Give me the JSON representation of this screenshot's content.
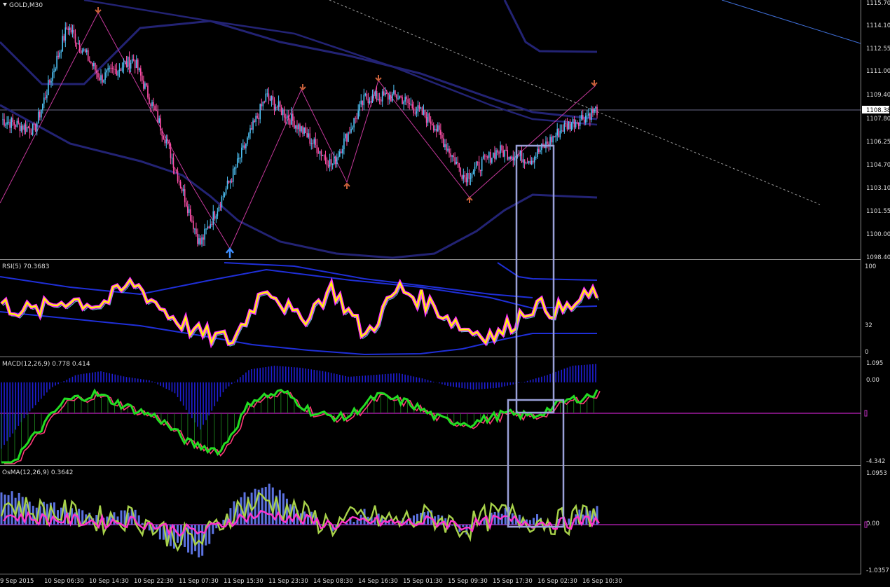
{
  "window": {
    "symbol_label": "GOLD,M30",
    "menu_icon": "triangle-down-icon"
  },
  "current_price": "1108.38",
  "panes": {
    "main": {
      "ticks": [
        "1115.70",
        "1114.10",
        "1112.55",
        "1111.00",
        "1109.40",
        "1107.80",
        "1106.25",
        "1104.70",
        "1103.10",
        "1101.55",
        "1100.00",
        "1098.40"
      ]
    },
    "rsi": {
      "label": "RSI(5) 70.3683",
      "ticks": [
        "100",
        "32",
        "0"
      ]
    },
    "macd": {
      "label": "MACD(12,26,9) 0.778 0.414",
      "ticks": [
        "1.095",
        "0.00",
        "-4.342"
      ]
    },
    "osma": {
      "label": "OsMA(12,26,9) 0.3642",
      "ticks": [
        "1.0953",
        "0.00",
        "-1.0357"
      ]
    }
  },
  "time_labels": [
    "9 Sep 2015",
    "10 Sep 06:30",
    "10 Sep 14:30",
    "10 Sep 22:30",
    "11 Sep 07:30",
    "11 Sep 15:30",
    "11 Sep 23:30",
    "14 Sep 08:30",
    "14 Sep 16:30",
    "15 Sep 01:30",
    "15 Sep 09:30",
    "15 Sep 17:30",
    "16 Sep 02:30",
    "16 Sep 10:30"
  ],
  "colors": {
    "background": "#000000",
    "grid_text": "#dcdcdc",
    "bull_candle": "#4fc3f7",
    "bear_candle": "#ff4fa8",
    "bands": "#232374",
    "rsi_main": "#ffff00",
    "rsi_glow": "#ff33ff",
    "macd_hist": "#1f1fd6",
    "macd_line": "#22dd22",
    "macd_signal": "#ff3b7a",
    "osma_bar": "#5b72e0",
    "osma_line": "#a8d24a",
    "osma_signal": "#ff33cc",
    "zone_box": "#9aa0d8"
  },
  "chart_data": [
    {
      "type": "line",
      "title": "GOLD,M30",
      "x_labels": [
        "9 Sep 2015",
        "10 Sep 06:30",
        "10 Sep 14:30",
        "10 Sep 22:30",
        "11 Sep 07:30",
        "11 Sep 15:30",
        "11 Sep 23:30",
        "14 Sep 08:30",
        "14 Sep 16:30",
        "15 Sep 01:30",
        "15 Sep 09:30",
        "15 Sep 17:30",
        "16 Sep 02:30",
        "16 Sep 10:30"
      ],
      "ylim": [
        1098.4,
        1115.7
      ],
      "series": [
        {
          "values": [
            1107.7,
            1107.0,
            1114.1,
            1110.5,
            1111.8,
            1106.2,
            1099.2,
            1104.0,
            1109.3,
            1107.2,
            1104.6,
            1109.2,
            1109.3,
            1107.6,
            1103.8,
            1105.6,
            1105.0,
            1107.2,
            1108.38
          ]
        }
      ]
    },
    {
      "type": "line",
      "title": "RSI(5) 70.3683",
      "ylim": [
        0,
        100
      ],
      "series": [
        {
          "values": [
            55,
            47,
            62,
            55,
            80,
            46,
            22,
            15,
            78,
            36,
            74,
            20,
            74,
            55,
            28,
            20,
            54,
            48,
            70
          ]
        }
      ]
    },
    {
      "type": "bar",
      "title": "MACD(12,26,9) 0.778 0.414",
      "ylim": [
        -4.342,
        1.095
      ],
      "series": [
        {
          "values": [
            -3.5,
            -1.5,
            0.5,
            0.9,
            0.2,
            -0.4,
            -1.8,
            -2.2,
            0.6,
            1.0,
            -0.2,
            -0.4,
            0.8,
            0.4,
            -0.5,
            -0.7,
            -0.2,
            -0.3,
            0.5,
            0.9
          ]
        }
      ]
    },
    {
      "type": "bar",
      "title": "OsMA(12,26,9) 0.3642",
      "ylim": [
        -1.0357,
        1.0953
      ],
      "series": [
        {
          "values": [
            0.7,
            0.4,
            0.3,
            0.1,
            0.2,
            -0.4,
            -0.7,
            0.4,
            0.8,
            0.3,
            -0.1,
            0.2,
            0.0,
            0.2,
            -0.2,
            0.3,
            0.1,
            0.0,
            0.36
          ]
        }
      ]
    }
  ]
}
